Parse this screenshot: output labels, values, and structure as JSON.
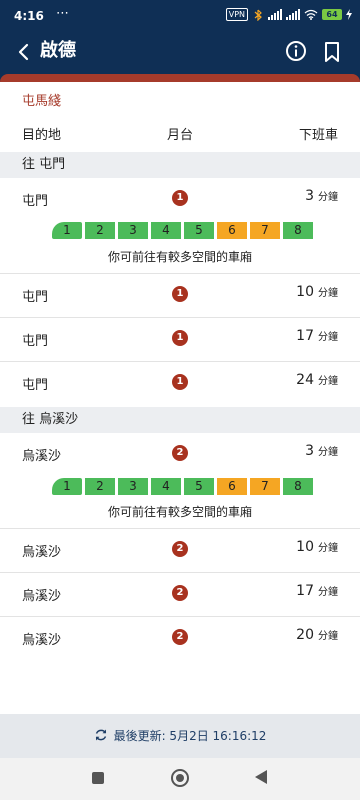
{
  "status": {
    "time": "4:16",
    "dots": "⋯",
    "vpn": "VPN",
    "battery": "64"
  },
  "appbar": {
    "title": "啟德"
  },
  "line": {
    "name": "屯馬綫"
  },
  "columns": {
    "destination": "目的地",
    "platform": "月台",
    "next_train": "下班車"
  },
  "sections": [
    {
      "heading": "往 屯門",
      "rows": [
        {
          "dest": "屯門",
          "platform": "1",
          "eta": "3",
          "unit": "分鐘"
        },
        {
          "dest": "屯門",
          "platform": "1",
          "eta": "10",
          "unit": "分鐘"
        },
        {
          "dest": "屯門",
          "platform": "1",
          "eta": "17",
          "unit": "分鐘"
        },
        {
          "dest": "屯門",
          "platform": "1",
          "eta": "24",
          "unit": "分鐘"
        }
      ]
    },
    {
      "heading": "往 烏溪沙",
      "rows": [
        {
          "dest": "烏溪沙",
          "platform": "2",
          "eta": "3",
          "unit": "分鐘"
        },
        {
          "dest": "烏溪沙",
          "platform": "2",
          "eta": "10",
          "unit": "分鐘"
        },
        {
          "dest": "烏溪沙",
          "platform": "2",
          "eta": "17",
          "unit": "分鐘"
        },
        {
          "dest": "烏溪沙",
          "platform": "2",
          "eta": "20",
          "unit": "分鐘"
        }
      ]
    }
  ],
  "cars": {
    "labels": [
      "1",
      "2",
      "3",
      "4",
      "5",
      "6",
      "7",
      "8"
    ],
    "status": [
      "green",
      "green",
      "green",
      "green",
      "green",
      "orange",
      "orange",
      "green"
    ],
    "note": "你可前往有較多空間的車廂"
  },
  "footer": {
    "last_updated": "最後更新: 5月2日 16:16:12"
  },
  "colors": {
    "primary": "#0f2f55",
    "line_accent": "#a63b2b",
    "platform_badge": "#a8321f",
    "car_green": "#4cbb5a",
    "car_orange": "#f5a623"
  }
}
